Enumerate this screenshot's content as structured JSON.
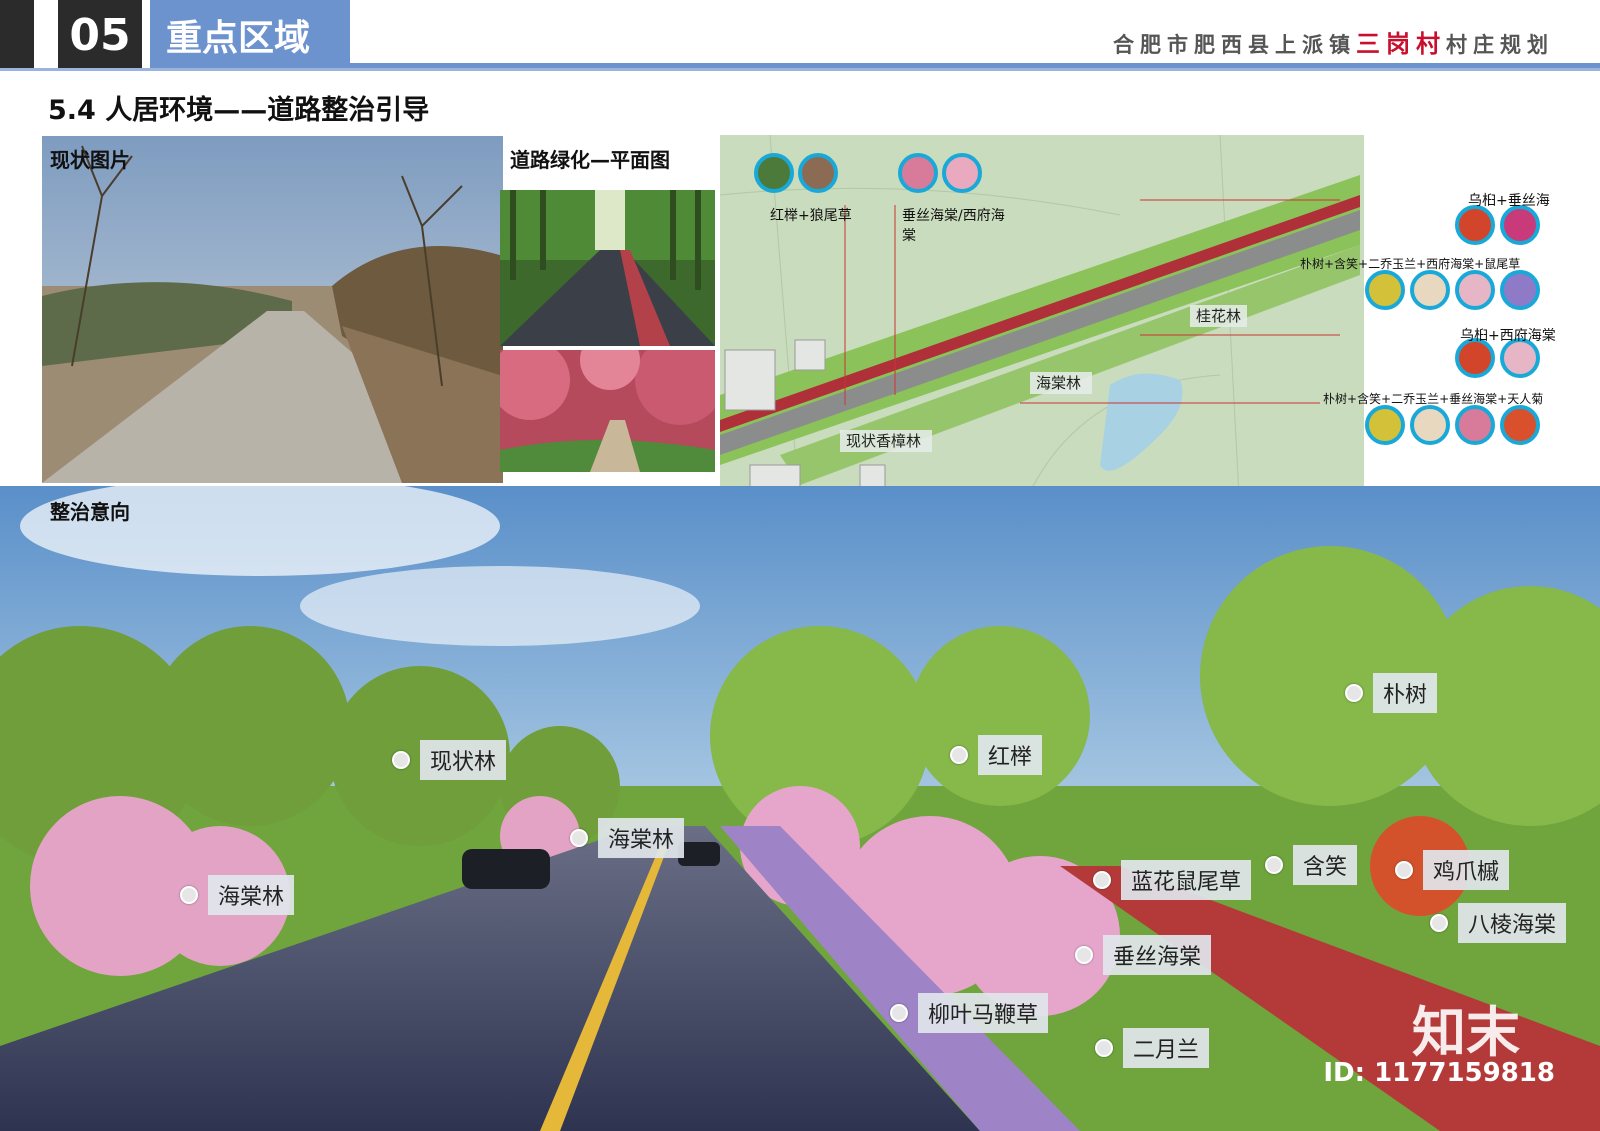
{
  "header": {
    "number": "05",
    "title": "重点区域",
    "project_pre": "合肥市肥西县上派镇",
    "project_highlight": "三岗村",
    "project_post": "村庄规划"
  },
  "section_title": "5.4 人居环境——道路整治引导",
  "panels": {
    "current": "现状图片",
    "plan": "道路绿化—平面图",
    "intent": "整治意向"
  },
  "plan_labels": {
    "top_left_1": "红榉+狼尾草",
    "top_left_2": "垂丝海棠/西府海棠",
    "right_1": "乌桕+垂丝海",
    "right_2": "朴树+含笑+二乔玉兰+西府海棠+鼠尾草",
    "right_3": "乌桕+西府海棠",
    "right_4": "朴树+含笑+二乔玉兰+垂丝海棠+天人菊",
    "tag_guihua": "桂花林",
    "tag_haitang": "海棠林",
    "tag_xiangzhang": "现状香樟林"
  },
  "callouts": {
    "xianzhuanglin": "现状林",
    "haitanglin_left": "海棠林",
    "haitanglin_mid": "海棠林",
    "hongju": "红榉",
    "pushu": "朴树",
    "hanxiao": "含笑",
    "jizhuaqi": "鸡爪槭",
    "lanhua": "蓝花鼠尾草",
    "baleng": "八棱海棠",
    "chuisi": "垂丝海棠",
    "liuye": "柳叶马鞭草",
    "eryuelan": "二月兰"
  },
  "watermark": {
    "text": "知末",
    "id": "ID: 1177159818"
  },
  "colors": {
    "accent_blue": "#6d93cf",
    "highlight_red": "#c8102e",
    "icon_ring": "#19a9d8"
  }
}
